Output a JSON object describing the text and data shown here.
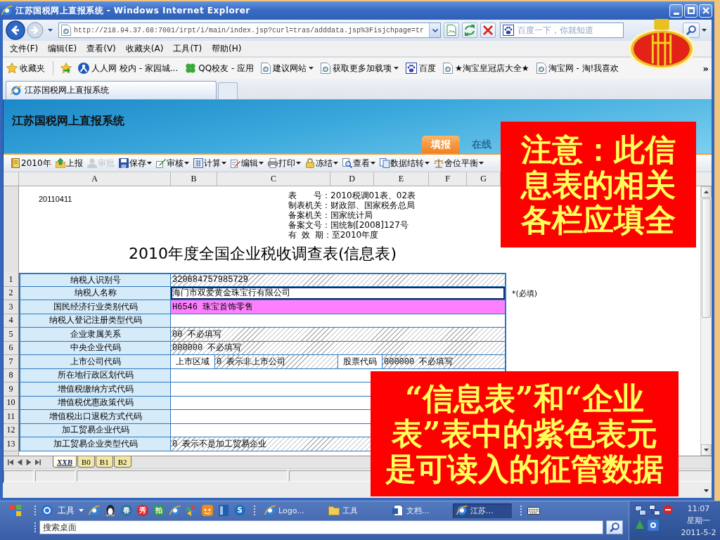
{
  "window": {
    "title": "江苏国税网上直报系统 - Windows Internet Explorer"
  },
  "address_bar": {
    "url": "http://218.94.37.68:7001/irpt/i/main/index.jsp?curl=tras/adddata.jsp%3Fisjchpage=tr"
  },
  "search_box": {
    "placeholder": "百度一下，你就知道"
  },
  "menu": [
    "文件(F)",
    "编辑(E)",
    "查看(V)",
    "收藏夹(A)",
    "工具(T)",
    "帮助(H)"
  ],
  "favorites_bar": {
    "label": "收藏夹",
    "items": [
      {
        "label": "人人网 校内 - 家园城...",
        "dropdown": false
      },
      {
        "label": "QQ校友 - 应用",
        "dropdown": false
      },
      {
        "label": "建议网站",
        "dropdown": true
      },
      {
        "label": "获取更多加载项",
        "dropdown": true
      },
      {
        "label": "百度",
        "dropdown": false
      },
      {
        "label": "★淘宝皇冠店大全★",
        "dropdown": false
      },
      {
        "label": "淘宝网 - 淘!我喜欢",
        "dropdown": false
      }
    ],
    "overflow": "»"
  },
  "browser_tabs": [
    {
      "label": "江苏国税网上直报系统",
      "selected": true
    }
  ],
  "column_bar": {
    "letters": [
      "A",
      "B",
      "C",
      "D",
      "E",
      "F",
      "G"
    ]
  },
  "app": {
    "title": "江苏国税网上直报系统",
    "tabs": [
      {
        "label": "填报",
        "selected": true
      },
      {
        "label": "在线",
        "selected": false
      }
    ],
    "toolbar": [
      {
        "label": "2010年",
        "disabled": false,
        "dropdown": false
      },
      {
        "label": "上报",
        "disabled": false,
        "dropdown": false
      },
      {
        "label": "审批",
        "disabled": true,
        "dropdown": false
      },
      {
        "label": "保存",
        "disabled": false,
        "dropdown": true
      },
      {
        "label": "审核",
        "disabled": false,
        "dropdown": true
      },
      {
        "label": "计算",
        "disabled": false,
        "dropdown": true
      },
      {
        "label": "编辑",
        "disabled": false,
        "dropdown": true
      },
      {
        "label": "打印",
        "disabled": false,
        "dropdown": true
      },
      {
        "label": "冻结",
        "disabled": false,
        "dropdown": true
      },
      {
        "label": "查看",
        "disabled": false,
        "dropdown": true
      },
      {
        "label": "数据结转",
        "disabled": false,
        "dropdown": true
      },
      {
        "label": "舍位平衡",
        "disabled": false,
        "dropdown": true
      }
    ],
    "stamp": "20110411",
    "form_info": [
      "表　　号：2010税调01表、02表",
      "制表机关：财政部、国家税务总局",
      "备案机关：国家统计局",
      "备案文号：国统制[2008]127号",
      "有 效 期：至2010年度"
    ],
    "form_title": "2010年度全国企业税收调查表(信息表)",
    "rows": [
      {
        "number": "1",
        "label": "纳税人识别号",
        "selected": false,
        "cells": [
          {
            "kind": "locked",
            "text": "320684757985729"
          }
        ]
      },
      {
        "number": "2",
        "label": "纳税人名称",
        "selected": true,
        "cells": [
          {
            "kind": "editable",
            "text": "海门市双爱黄金珠宝行有限公司"
          }
        ],
        "note": "*(必填)"
      },
      {
        "number": "3",
        "label": "国民经济行业类别代码",
        "selected": false,
        "cells": [
          {
            "kind": "imported",
            "text": "H6546 珠宝首饰零售"
          }
        ]
      },
      {
        "number": "4",
        "label": "纳税人登记注册类型代码",
        "selected": false,
        "cells": [
          {
            "kind": "editable"
          }
        ]
      },
      {
        "number": "5",
        "label": "企业隶属关系",
        "selected": false,
        "cells": [
          {
            "kind": "locked",
            "text": "00 不必填写"
          }
        ]
      },
      {
        "number": "6",
        "label": "中央企业代码",
        "selected": false,
        "cells": [
          {
            "kind": "locked",
            "text": "000000 不必填写"
          }
        ]
      },
      {
        "number": "7",
        "label": "上市公司代码",
        "selected": false,
        "cells": [
          {
            "kind": "caption",
            "text": "上市区域"
          },
          {
            "kind": "locked",
            "text": "0 表示非上市公司"
          },
          {
            "kind": "caption",
            "text": "股票代码"
          },
          {
            "kind": "locked",
            "text": "000000 不必填写"
          }
        ]
      },
      {
        "number": "8",
        "label": "所在地行政区划代码",
        "selected": false,
        "cells": [
          {
            "kind": "editable"
          }
        ]
      },
      {
        "number": "9",
        "label": "增值税缴纳方式代码",
        "selected": false,
        "cells": [
          {
            "kind": "editable"
          }
        ]
      },
      {
        "number": "10",
        "label": "增值税优惠政策代码",
        "selected": false,
        "cells": [
          {
            "kind": "editable"
          }
        ]
      },
      {
        "number": "11",
        "label": "增值税出口退税方式代码",
        "selected": false,
        "cells": [
          {
            "kind": "editable"
          }
        ]
      },
      {
        "number": "12",
        "label": "加工贸易企业代码",
        "selected": false,
        "cells": [
          {
            "kind": "editable"
          }
        ]
      },
      {
        "number": "13",
        "label": "加工贸易企业类型代码",
        "selected": false,
        "cells": [
          {
            "kind": "locked",
            "text": "0 表示不是加工贸易企业"
          }
        ]
      }
    ],
    "sheet_tabs": [
      {
        "label": "XXB",
        "selected": true
      },
      {
        "label": "B0",
        "selected": false
      },
      {
        "label": "B1",
        "selected": false
      },
      {
        "label": "B2",
        "selected": false
      }
    ]
  },
  "notes": [
    {
      "lines": [
        "注意：此信",
        "息表的相关",
        "各栏应填全"
      ]
    },
    {
      "lines": [
        "“信息表”和“企业",
        "表”表中的紫色表元",
        "是可读入的征管数据"
      ]
    }
  ],
  "taskbar": {
    "toolbar_menu": "工具",
    "quick_launch": [
      {
        "kind": "icon"
      },
      {
        "kind": "icon"
      },
      {
        "kind": "glyph",
        "text": "春",
        "color": "#2f6f9f"
      },
      {
        "kind": "glyph",
        "text": "秀",
        "color": "#d8262a"
      },
      {
        "kind": "glyph",
        "text": "拍",
        "color": "#2f9a3a"
      },
      {
        "kind": "icon"
      },
      {
        "kind": "icon"
      },
      {
        "kind": "icon"
      },
      {
        "kind": "icon"
      },
      {
        "kind": "glyph",
        "text": "S",
        "color": "#1f6fc0"
      }
    ],
    "task_buttons": [
      {
        "label": "Logo...",
        "selected": false
      },
      {
        "label": "工具",
        "selected": false
      },
      {
        "label": "文档...",
        "selected": false
      },
      {
        "label": "江苏...",
        "selected": true
      }
    ],
    "search": {
      "placeholder": "搜索桌面"
    },
    "clock": {
      "time": "11:07",
      "weekday": "星期一",
      "date": "2011-5-2"
    }
  }
}
